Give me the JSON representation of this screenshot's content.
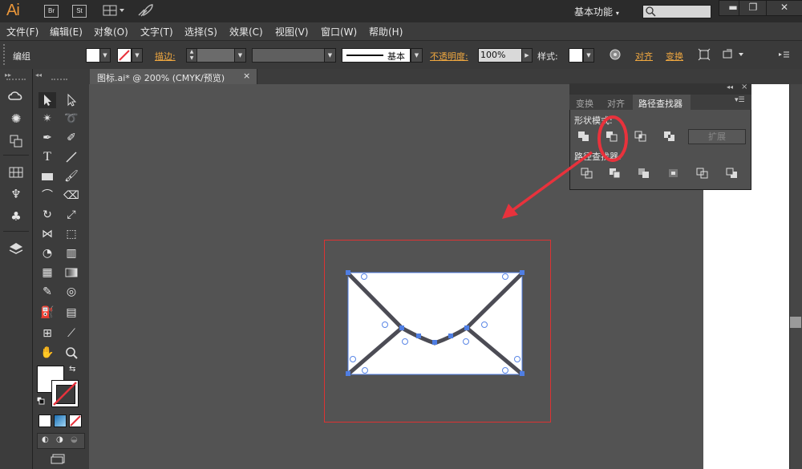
{
  "app": {
    "logo": "Ai",
    "bridge_btn": "Br",
    "stock_btn": "St",
    "workspace": "基本功能"
  },
  "menu": [
    "文件(F)",
    "编辑(E)",
    "对象(O)",
    "文字(T)",
    "选择(S)",
    "效果(C)",
    "视图(V)",
    "窗口(W)",
    "帮助(H)"
  ],
  "control": {
    "mode": "编组",
    "stroke_label": "描边:",
    "stroke_profile": "基本",
    "opacity_label": "不透明度:",
    "opacity_value": "100%",
    "style_label": "样式:",
    "align_link": "对齐",
    "transform_link": "变换"
  },
  "document": {
    "tab_title": "图标.ai* @ 200% (CMYK/预览)"
  },
  "pathfinder": {
    "tabs": [
      "变换",
      "对齐",
      "路径查找器"
    ],
    "shape_modes_label": "形状模式:",
    "pathfinders_label": "路径查找器:",
    "expand_label": "扩展"
  },
  "colors": {
    "accent_orange": "#f0a840",
    "annotation_red": "#e8323c",
    "selection_blue": "#4f7ee3",
    "stroke_dark": "#4c4c55"
  }
}
